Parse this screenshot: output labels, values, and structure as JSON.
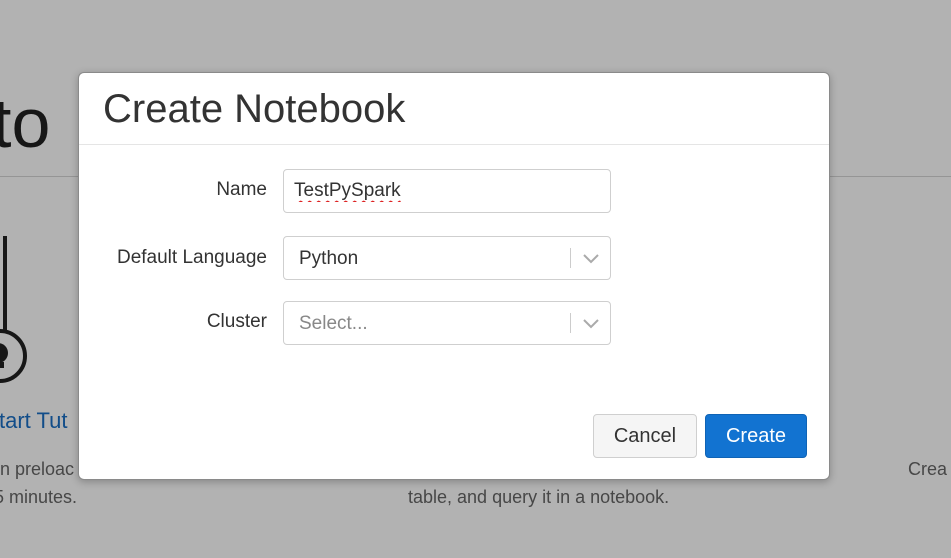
{
  "background": {
    "heading_fragment": "to",
    "tutorial_link": "start Tut",
    "tutorial_desc_line1": "on preloac",
    "tutorial_desc_line2": "5 minutes.",
    "middle_desc_line2": "table, and query it in a notebook.",
    "right_desc": "Crea"
  },
  "modal": {
    "title": "Create Notebook",
    "name_label": "Name",
    "name_value": "TestPySpark",
    "language_label": "Default Language",
    "language_value": "Python",
    "cluster_label": "Cluster",
    "cluster_placeholder": "Select...",
    "cancel_label": "Cancel",
    "create_label": "Create"
  },
  "colors": {
    "primary_button": "#1273d1",
    "link": "#1a6fc4",
    "backdrop": "rgba(0,0,0,0.30)"
  },
  "icons": {
    "select_arrow": "chevron-down-icon",
    "background_tile": "lightbulb-icon"
  }
}
